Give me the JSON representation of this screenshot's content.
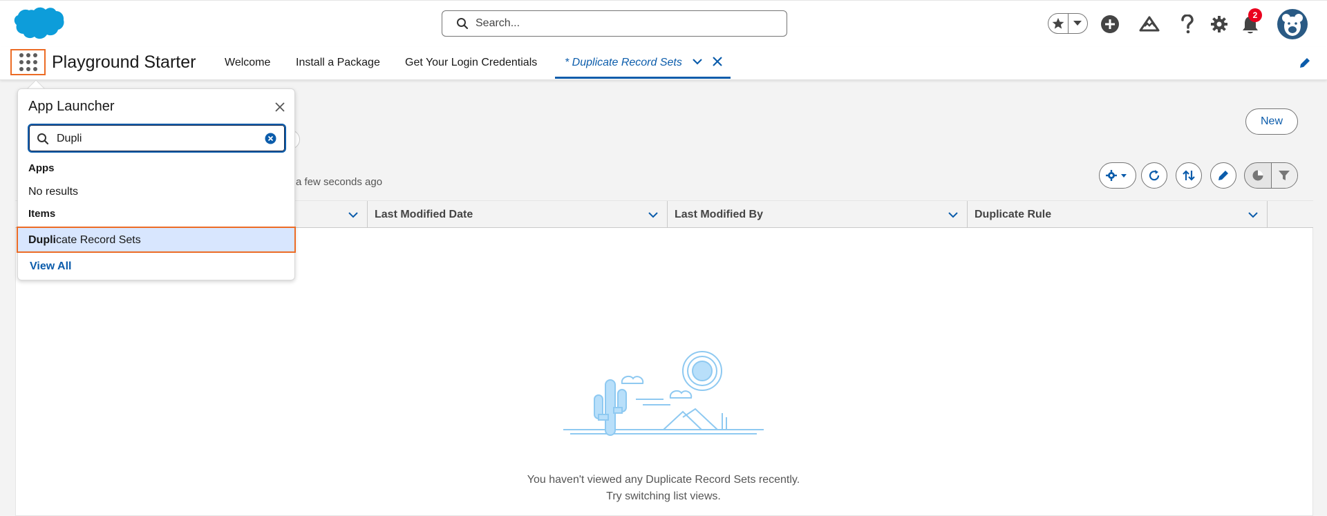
{
  "header": {
    "search_placeholder": "Search...",
    "notification_count": "2",
    "icons": [
      "favorites-star-icon",
      "favorites-dropdown-icon",
      "global-actions-add-icon",
      "trailhead-guidance-icon",
      "help-icon",
      "setup-gear-icon",
      "notifications-bell-icon",
      "user-avatar"
    ]
  },
  "nav": {
    "app_name": "Playground Starter",
    "items": [
      {
        "label": "Welcome"
      },
      {
        "label": "Install a Package"
      },
      {
        "label": "Get Your Login Credentials"
      }
    ],
    "active_tab": {
      "label": "* Duplicate Record Sets"
    }
  },
  "list_view": {
    "new_label": "New",
    "status_fragment": "a few seconds ago",
    "columns": [
      {
        "label": ""
      },
      {
        "label": "Last Modified Date"
      },
      {
        "label": "Last Modified By"
      },
      {
        "label": "Duplicate Rule"
      }
    ],
    "empty_line1": "You haven't viewed any Duplicate Record Sets recently.",
    "empty_line2": "Try switching list views."
  },
  "launcher": {
    "title": "App Launcher",
    "search_value": "Dupli",
    "apps_heading": "Apps",
    "apps_no_results": "No results",
    "items_heading": "Items",
    "item_match": "Dupli",
    "item_rest": "cate Record Sets",
    "view_all": "View All"
  },
  "colors": {
    "brand_blue": "#0b5cab",
    "highlight_orange": "#ec6b24",
    "badge_red": "#ea001e",
    "selected_row": "#d8e6fe"
  }
}
